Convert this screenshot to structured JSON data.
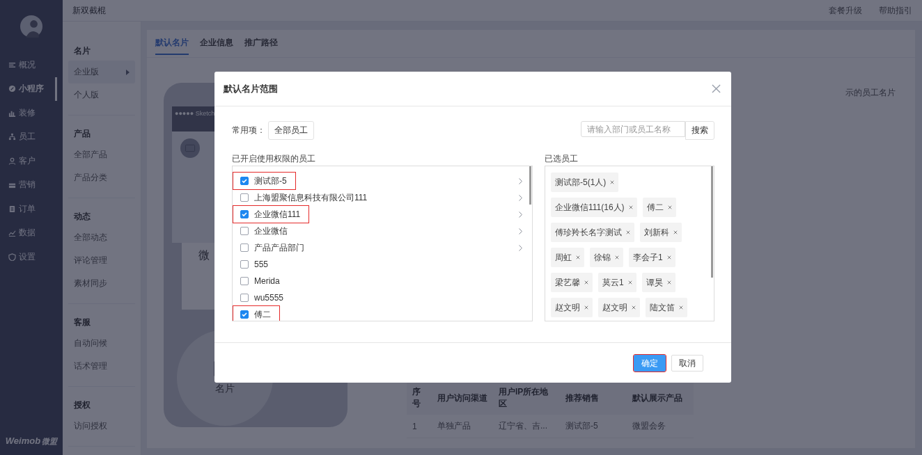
{
  "header": {
    "app_name": "新双截棍",
    "links": [
      "套餐升级",
      "帮助指引"
    ]
  },
  "main_nav": [
    {
      "label": "概况",
      "selected": false
    },
    {
      "label": "小程序",
      "selected": true
    },
    {
      "label": "装修",
      "selected": false
    },
    {
      "label": "员工",
      "selected": false
    },
    {
      "label": "客户",
      "selected": false
    },
    {
      "label": "营销",
      "selected": false
    },
    {
      "label": "订单",
      "selected": false
    },
    {
      "label": "数据",
      "selected": false
    },
    {
      "label": "设置",
      "selected": false
    }
  ],
  "brand": {
    "latin": "Weimob",
    "cjk": "微盟"
  },
  "sub_nav": [
    {
      "title": "名片",
      "items": [
        {
          "label": "企业版",
          "selected": true
        },
        {
          "label": "个人版",
          "selected": false
        }
      ]
    },
    {
      "title": "产品",
      "items": [
        {
          "label": "全部产品",
          "selected": false
        },
        {
          "label": "产品分类",
          "selected": false
        }
      ]
    },
    {
      "title": "动态",
      "items": [
        {
          "label": "全部动态",
          "selected": false
        },
        {
          "label": "评论管理",
          "selected": false
        },
        {
          "label": "素材同步",
          "selected": false
        }
      ]
    },
    {
      "title": "客服",
      "items": [
        {
          "label": "自动问候",
          "selected": false
        },
        {
          "label": "话术管理",
          "selected": false
        }
      ]
    },
    {
      "title": "授权",
      "items": [
        {
          "label": "访问授权",
          "selected": false
        }
      ]
    }
  ],
  "tabs": [
    {
      "label": "默认名片",
      "selected": true
    },
    {
      "label": "企业信息",
      "selected": false
    },
    {
      "label": "推广路径",
      "selected": false
    }
  ],
  "hint_text": "示的员工名片",
  "phone": {
    "status": "●●●●● Sketch",
    "card_title": "微",
    "button_label": "名片"
  },
  "table": {
    "columns": [
      "序号",
      "用户访问渠道",
      "用户IP所在地区",
      "推荐销售",
      "默认展示产品"
    ],
    "rows": [
      [
        "1",
        "单独产品",
        "辽宁省、吉...",
        "测试部-5",
        "微盟会务"
      ]
    ]
  },
  "dialog": {
    "title": "默认名片范围",
    "preset_label": "常用项：",
    "preset_button": "全部员工",
    "search": {
      "placeholder": "请输入部门或员工名称",
      "button": "搜索"
    },
    "left_title": "已开启使用权限的员工",
    "departments": [
      {
        "label": "测试部-5",
        "checked": true,
        "has_children": true,
        "annotated": true
      },
      {
        "label": "上海盟聚信息科技有限公司111",
        "checked": false,
        "has_children": true,
        "annotated": false
      },
      {
        "label": "企业微信111",
        "checked": true,
        "has_children": true,
        "annotated": true
      },
      {
        "label": "企业微信",
        "checked": false,
        "has_children": true,
        "annotated": false
      },
      {
        "label": "产品产品部门",
        "checked": false,
        "has_children": true,
        "annotated": false
      },
      {
        "label": "555",
        "checked": false,
        "has_children": false,
        "annotated": false
      },
      {
        "label": "Merida",
        "checked": false,
        "has_children": false,
        "annotated": false
      },
      {
        "label": "wu5555",
        "checked": false,
        "has_children": false,
        "annotated": false
      },
      {
        "label": "傅二",
        "checked": true,
        "has_children": false,
        "annotated": true
      }
    ],
    "right_title": "已选员工",
    "selected": [
      "测试部-5(1人)",
      "企业微信111(16人)",
      "傅二",
      "傅珍羚长名字测试",
      "刘新科",
      "周虹",
      "徐锦",
      "李会子1",
      "梁艺馨",
      "莫云1",
      "谭昊",
      "赵文明",
      "赵文明",
      "陆文笛"
    ],
    "buttons": [
      {
        "label": "确定",
        "kind": "primary",
        "annotated": true
      },
      {
        "label": "取消",
        "kind": "default",
        "annotated": false
      }
    ]
  }
}
